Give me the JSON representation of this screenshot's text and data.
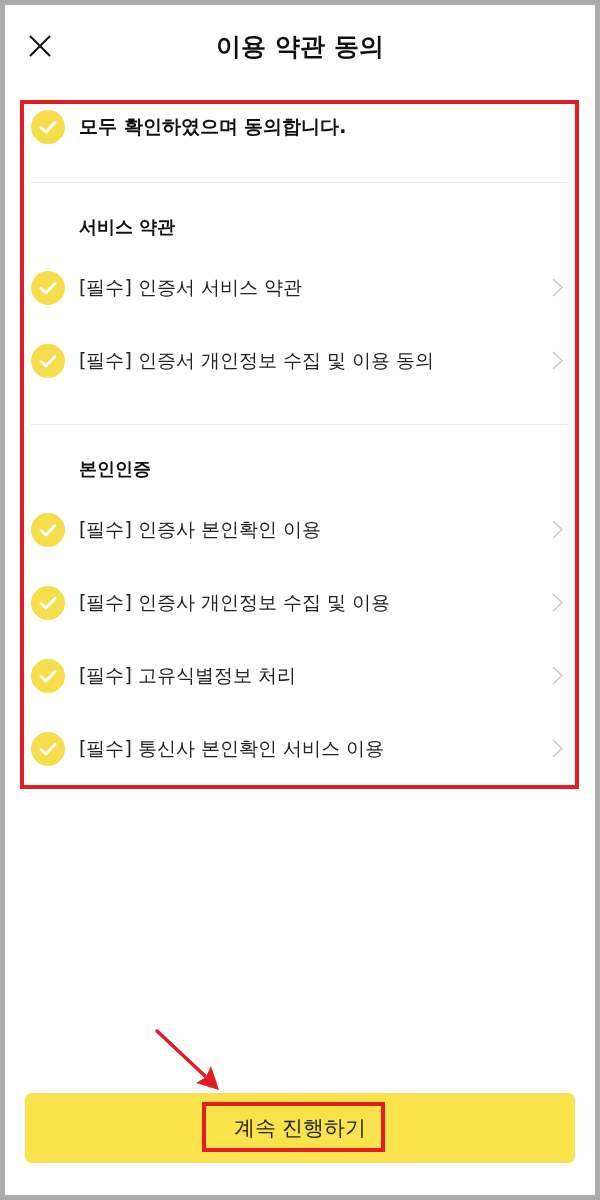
{
  "header": {
    "title": "이용 약관 동의"
  },
  "agree_all": {
    "label": "모두 확인하였으며 동의합니다.",
    "checked": true
  },
  "sections": [
    {
      "heading": "서비스 약관",
      "items": [
        {
          "label": "[필수] 인증서 서비스 약관",
          "checked": true
        },
        {
          "label": "[필수] 인증서 개인정보 수집 및 이용 동의",
          "checked": true
        }
      ]
    },
    {
      "heading": "본인인증",
      "items": [
        {
          "label": "[필수] 인증사 본인확인 이용",
          "checked": true
        },
        {
          "label": "[필수] 인증사 개인정보 수집 및 이용",
          "checked": true
        },
        {
          "label": "[필수] 고유식별정보 처리",
          "checked": true
        },
        {
          "label": "[필수] 통신사 본인확인 서비스 이용",
          "checked": true
        }
      ]
    }
  ],
  "continue_button": {
    "label": "계속 진행하기"
  }
}
